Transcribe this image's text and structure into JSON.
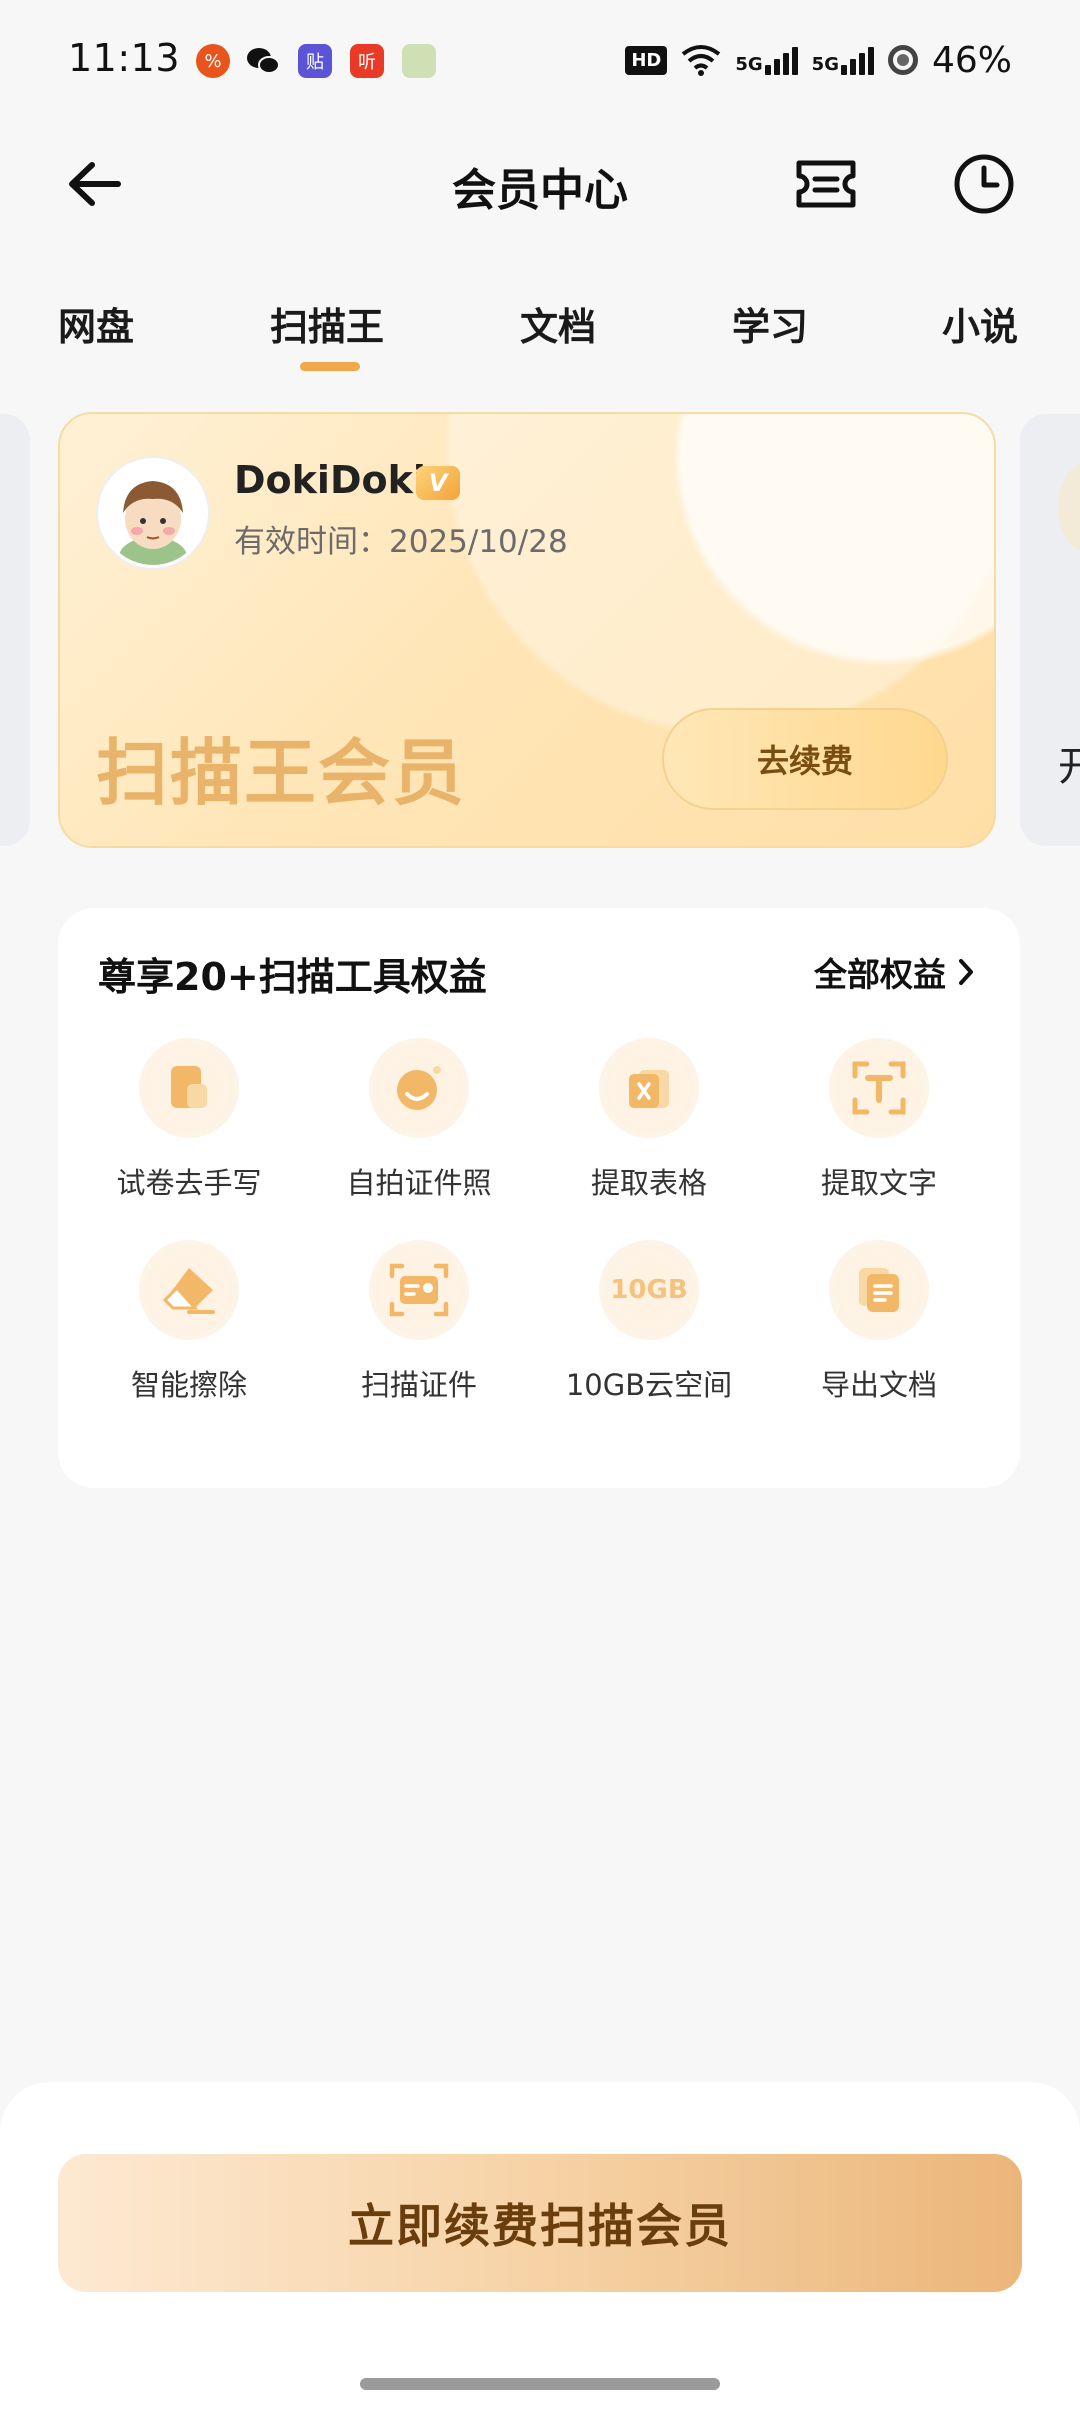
{
  "status_bar": {
    "time": "11:13",
    "apps": [
      "pinduoduo-icon",
      "wechat-icon",
      "tieba-icon",
      "ting-icon",
      "game-avatar-icon"
    ],
    "hd_badge": "HD",
    "net1": "5G",
    "net2": "5G",
    "battery": "46%"
  },
  "header": {
    "title": "会员中心",
    "back_icon": "back-arrow-icon",
    "ticket_icon": "ticket-icon",
    "history_icon": "clock-icon"
  },
  "tabs": [
    {
      "label": "网盘"
    },
    {
      "label": "扫描王",
      "active": true
    },
    {
      "label": "文档"
    },
    {
      "label": "学习"
    },
    {
      "label": "小说"
    }
  ],
  "member_card": {
    "username": "DokiDoki",
    "vip_badge": "V",
    "expiry": "有效时间：2025/10/28",
    "title": "扫描王会员",
    "renew_button": "去续费"
  },
  "side_card": {
    "peek_text": "开"
  },
  "benefits": {
    "title": "尊享20+扫描工具权益",
    "all_link": "全部权益",
    "items": [
      {
        "label": "试卷去手写",
        "icon": "exam-paper-icon"
      },
      {
        "label": "自拍证件照",
        "icon": "selfie-icon"
      },
      {
        "label": "提取表格",
        "icon": "excel-icon"
      },
      {
        "label": "提取文字",
        "icon": "text-extract-icon"
      },
      {
        "label": "智能擦除",
        "icon": "eraser-icon"
      },
      {
        "label": "扫描证件",
        "icon": "id-card-icon"
      },
      {
        "label": "10GB云空间",
        "icon": "cloud-storage-icon",
        "glyph": "10GB"
      },
      {
        "label": "导出文档",
        "icon": "export-document-icon"
      }
    ]
  },
  "cta": {
    "label": "立即续费扫描会员"
  },
  "colors": {
    "accent": "#f0a94a",
    "card_title": "#e9b36a",
    "cta_text": "#6a3d0c"
  }
}
